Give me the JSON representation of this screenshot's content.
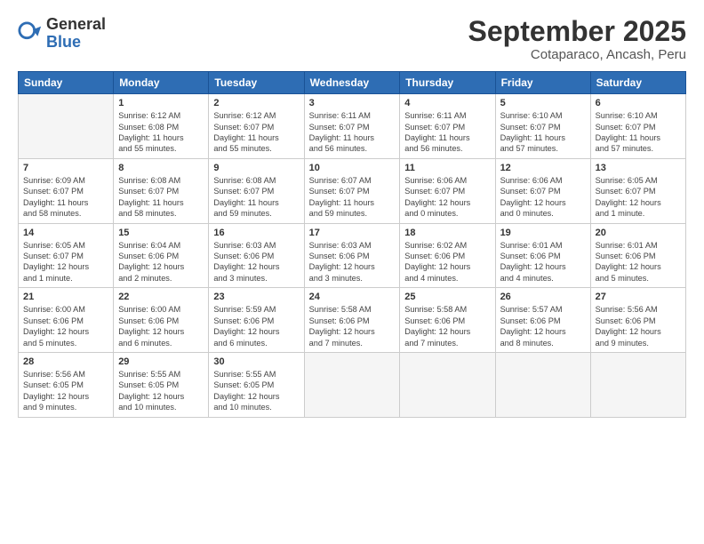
{
  "header": {
    "logo_general": "General",
    "logo_blue": "Blue",
    "title": "September 2025",
    "subtitle": "Cotaparaco, Ancash, Peru"
  },
  "calendar": {
    "days_of_week": [
      "Sunday",
      "Monday",
      "Tuesday",
      "Wednesday",
      "Thursday",
      "Friday",
      "Saturday"
    ],
    "weeks": [
      [
        {
          "day": "",
          "info": ""
        },
        {
          "day": "1",
          "info": "Sunrise: 6:12 AM\nSunset: 6:08 PM\nDaylight: 11 hours\nand 55 minutes."
        },
        {
          "day": "2",
          "info": "Sunrise: 6:12 AM\nSunset: 6:07 PM\nDaylight: 11 hours\nand 55 minutes."
        },
        {
          "day": "3",
          "info": "Sunrise: 6:11 AM\nSunset: 6:07 PM\nDaylight: 11 hours\nand 56 minutes."
        },
        {
          "day": "4",
          "info": "Sunrise: 6:11 AM\nSunset: 6:07 PM\nDaylight: 11 hours\nand 56 minutes."
        },
        {
          "day": "5",
          "info": "Sunrise: 6:10 AM\nSunset: 6:07 PM\nDaylight: 11 hours\nand 57 minutes."
        },
        {
          "day": "6",
          "info": "Sunrise: 6:10 AM\nSunset: 6:07 PM\nDaylight: 11 hours\nand 57 minutes."
        }
      ],
      [
        {
          "day": "7",
          "info": "Sunrise: 6:09 AM\nSunset: 6:07 PM\nDaylight: 11 hours\nand 58 minutes."
        },
        {
          "day": "8",
          "info": "Sunrise: 6:08 AM\nSunset: 6:07 PM\nDaylight: 11 hours\nand 58 minutes."
        },
        {
          "day": "9",
          "info": "Sunrise: 6:08 AM\nSunset: 6:07 PM\nDaylight: 11 hours\nand 59 minutes."
        },
        {
          "day": "10",
          "info": "Sunrise: 6:07 AM\nSunset: 6:07 PM\nDaylight: 11 hours\nand 59 minutes."
        },
        {
          "day": "11",
          "info": "Sunrise: 6:06 AM\nSunset: 6:07 PM\nDaylight: 12 hours\nand 0 minutes."
        },
        {
          "day": "12",
          "info": "Sunrise: 6:06 AM\nSunset: 6:07 PM\nDaylight: 12 hours\nand 0 minutes."
        },
        {
          "day": "13",
          "info": "Sunrise: 6:05 AM\nSunset: 6:07 PM\nDaylight: 12 hours\nand 1 minute."
        }
      ],
      [
        {
          "day": "14",
          "info": "Sunrise: 6:05 AM\nSunset: 6:07 PM\nDaylight: 12 hours\nand 1 minute."
        },
        {
          "day": "15",
          "info": "Sunrise: 6:04 AM\nSunset: 6:06 PM\nDaylight: 12 hours\nand 2 minutes."
        },
        {
          "day": "16",
          "info": "Sunrise: 6:03 AM\nSunset: 6:06 PM\nDaylight: 12 hours\nand 3 minutes."
        },
        {
          "day": "17",
          "info": "Sunrise: 6:03 AM\nSunset: 6:06 PM\nDaylight: 12 hours\nand 3 minutes."
        },
        {
          "day": "18",
          "info": "Sunrise: 6:02 AM\nSunset: 6:06 PM\nDaylight: 12 hours\nand 4 minutes."
        },
        {
          "day": "19",
          "info": "Sunrise: 6:01 AM\nSunset: 6:06 PM\nDaylight: 12 hours\nand 4 minutes."
        },
        {
          "day": "20",
          "info": "Sunrise: 6:01 AM\nSunset: 6:06 PM\nDaylight: 12 hours\nand 5 minutes."
        }
      ],
      [
        {
          "day": "21",
          "info": "Sunrise: 6:00 AM\nSunset: 6:06 PM\nDaylight: 12 hours\nand 5 minutes."
        },
        {
          "day": "22",
          "info": "Sunrise: 6:00 AM\nSunset: 6:06 PM\nDaylight: 12 hours\nand 6 minutes."
        },
        {
          "day": "23",
          "info": "Sunrise: 5:59 AM\nSunset: 6:06 PM\nDaylight: 12 hours\nand 6 minutes."
        },
        {
          "day": "24",
          "info": "Sunrise: 5:58 AM\nSunset: 6:06 PM\nDaylight: 12 hours\nand 7 minutes."
        },
        {
          "day": "25",
          "info": "Sunrise: 5:58 AM\nSunset: 6:06 PM\nDaylight: 12 hours\nand 7 minutes."
        },
        {
          "day": "26",
          "info": "Sunrise: 5:57 AM\nSunset: 6:06 PM\nDaylight: 12 hours\nand 8 minutes."
        },
        {
          "day": "27",
          "info": "Sunrise: 5:56 AM\nSunset: 6:06 PM\nDaylight: 12 hours\nand 9 minutes."
        }
      ],
      [
        {
          "day": "28",
          "info": "Sunrise: 5:56 AM\nSunset: 6:05 PM\nDaylight: 12 hours\nand 9 minutes."
        },
        {
          "day": "29",
          "info": "Sunrise: 5:55 AM\nSunset: 6:05 PM\nDaylight: 12 hours\nand 10 minutes."
        },
        {
          "day": "30",
          "info": "Sunrise: 5:55 AM\nSunset: 6:05 PM\nDaylight: 12 hours\nand 10 minutes."
        },
        {
          "day": "",
          "info": ""
        },
        {
          "day": "",
          "info": ""
        },
        {
          "day": "",
          "info": ""
        },
        {
          "day": "",
          "info": ""
        }
      ]
    ]
  }
}
